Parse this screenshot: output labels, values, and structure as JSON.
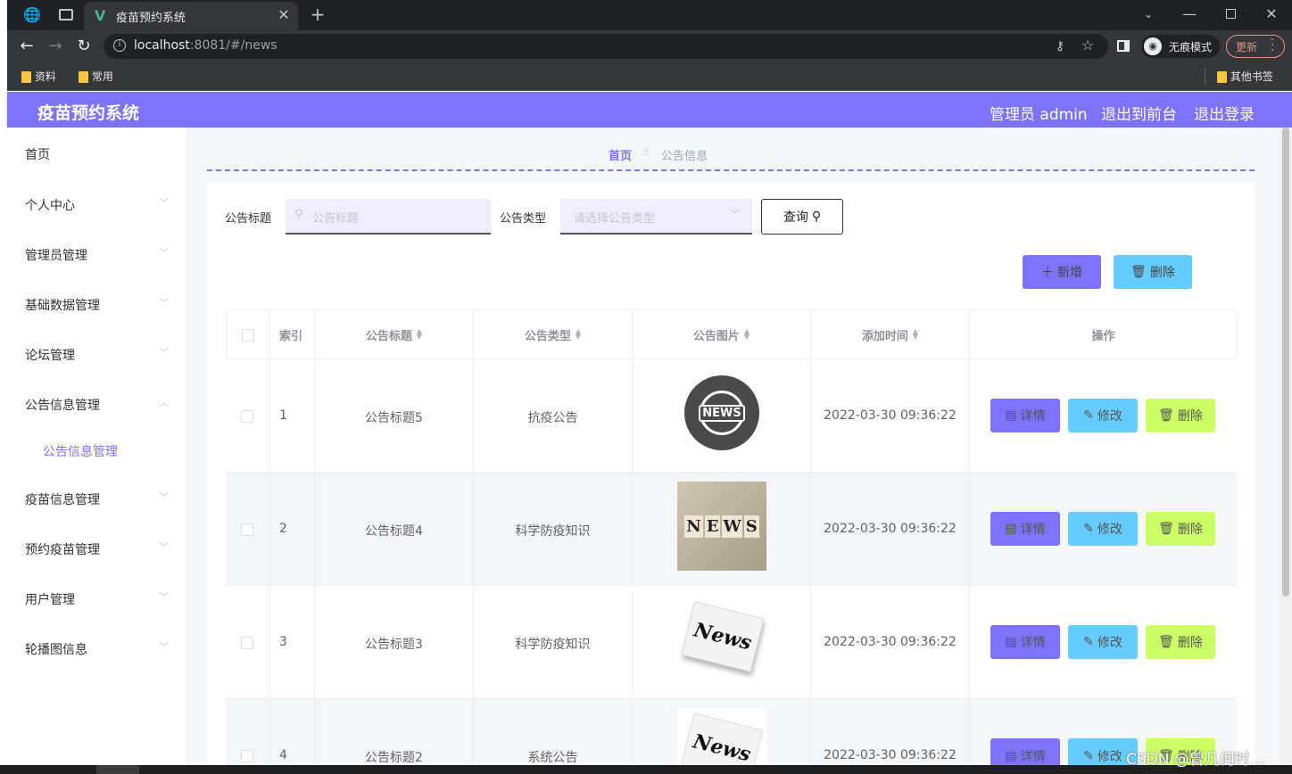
{
  "browser": {
    "tab_title": "疫苗预约系统",
    "url_host": "localhost",
    "url_rest": ":8081/#/news",
    "incognito_label": "无痕模式",
    "update_label": "更新",
    "bookmarks": [
      "资料",
      "常用"
    ],
    "other_bookmarks": "其他书签"
  },
  "app": {
    "title": "疫苗预约系统",
    "admin_label": "管理员 admin",
    "exit_front": "退出到前台",
    "logout": "退出登录",
    "accent": "#7c73f9"
  },
  "sidebar": {
    "items": [
      {
        "label": "首页",
        "arrow": ""
      },
      {
        "label": "个人中心",
        "arrow": "down"
      },
      {
        "label": "管理员管理",
        "arrow": "down"
      },
      {
        "label": "基础数据管理",
        "arrow": "down"
      },
      {
        "label": "论坛管理",
        "arrow": "down"
      },
      {
        "label": "公告信息管理",
        "arrow": "up"
      },
      {
        "label": "疫苗信息管理",
        "arrow": "down"
      },
      {
        "label": "预约疫苗管理",
        "arrow": "down"
      },
      {
        "label": "用户管理",
        "arrow": "down"
      },
      {
        "label": "轮播图信息",
        "arrow": "down"
      }
    ],
    "sub_item": "公告信息管理"
  },
  "breadcrumb": {
    "home": "首页",
    "current": "公告信息"
  },
  "search": {
    "title_label": "公告标题",
    "title_placeholder": "公告标题",
    "type_label": "公告类型",
    "type_placeholder": "请选择公告类型",
    "query_button": "查询"
  },
  "actions": {
    "add": "新增",
    "delete": "删除"
  },
  "table": {
    "headers": [
      "索引",
      "公告标题",
      "公告类型",
      "公告图片",
      "添加时间",
      "操作"
    ],
    "rows": [
      {
        "index": "1",
        "title": "公告标题5",
        "type": "抗疫公告",
        "image": "news-globe-icon",
        "time": "2022-03-30 09:36:22"
      },
      {
        "index": "2",
        "title": "公告标题4",
        "type": "科学防疫知识",
        "image": "news-blocks-image",
        "time": "2022-03-30 09:36:22"
      },
      {
        "index": "3",
        "title": "公告标题3",
        "type": "科学防疫知识",
        "image": "news-paper-image",
        "time": "2022-03-30 09:36:22"
      },
      {
        "index": "4",
        "title": "公告标题2",
        "type": "系统公告",
        "image": "news-paper-image",
        "time": "2022-03-30 09:36:22"
      }
    ],
    "row_actions": {
      "detail": "详情",
      "edit": "修改",
      "delete": "删除"
    }
  },
  "watermark": "CSDN @曾几何时…",
  "colors": {
    "detail": "#7c73f9",
    "edit": "#66ccff",
    "delete_row": "#ccff66",
    "delete_top": "#66ccff",
    "header": "#7c73f9"
  }
}
